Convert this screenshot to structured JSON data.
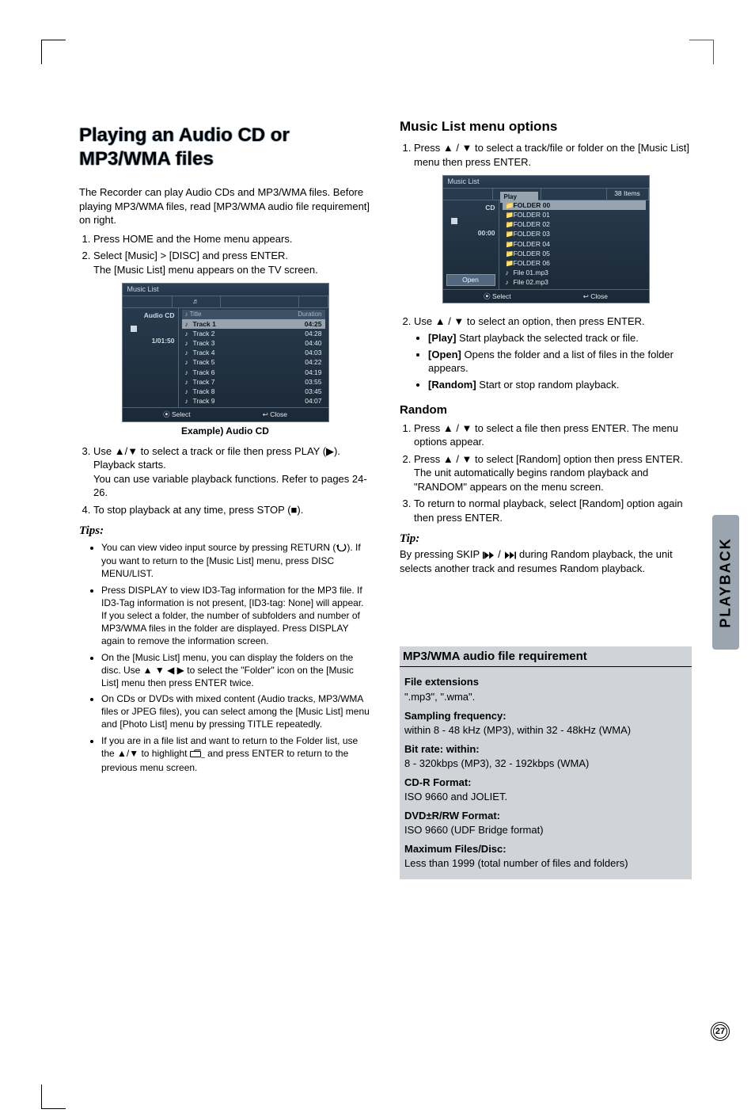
{
  "sideTab": "PLAYBACK",
  "pageNumber": "27",
  "left": {
    "title": "Playing an Audio CD or MP3/WMA files",
    "intro": "The Recorder can play Audio CDs and MP3/WMA files. Before playing MP3/WMA files, read [MP3/WMA audio file requirement] on right.",
    "step1": "Press HOME and the Home menu appears.",
    "step2a": "Select [Music] > [DISC] and press ENTER.",
    "step2b": "The [Music List] menu appears on the TV screen.",
    "exampleCaption": "Example) Audio CD",
    "step3a": "Use ▲/▼ to select a track or file then press PLAY (",
    "step3b": "). Playback starts.",
    "step3c": "You can use variable playback functions. Refer to pages 24-26.",
    "step4": "To stop playback at any time, press STOP (■).",
    "tipsLabel": "Tips:",
    "tip1a": "You can view video input source by pressing RETURN (",
    "tip1b": "). If you want to return to the [Music List] menu, press DISC MENU/LIST.",
    "tip2": "Press DISPLAY to view ID3-Tag information for the MP3 file. If ID3-Tag information is not present, [ID3-tag: None] will appear. If you select a folder, the number of subfolders and number of MP3/WMA files in the folder are displayed. Press DISPLAY again to remove the information screen.",
    "tip3": "On the [Music List] menu, you can display the folders on the disc. Use ▲ ▼ ◀ ▶ to select the \"Folder\" icon on the [Music List] menu then press ENTER twice.",
    "tip4": "On CDs or DVDs with mixed content (Audio tracks, MP3/WMA files or JPEG files), you can select among the [Music List] menu and [Photo List] menu by pressing TITLE repeatedly.",
    "tip5a": "If you are in a file list and want to return to the Folder list, use the ▲/▼ to highlight ",
    "tip5b": " and press ENTER to return to the previous menu screen.",
    "osd1": {
      "windowTitle": "Music List",
      "tabIcon": "♬",
      "side_label1": "Audio CD",
      "side_label2": "1/01:50",
      "head_title": "Title",
      "head_dur": "Duration",
      "tracks": [
        {
          "t": "Track 1",
          "d": "04:25"
        },
        {
          "t": "Track 2",
          "d": "04:28"
        },
        {
          "t": "Track 3",
          "d": "04:40"
        },
        {
          "t": "Track 4",
          "d": "04:03"
        },
        {
          "t": "Track 5",
          "d": "04:22"
        },
        {
          "t": "Track 6",
          "d": "04:19"
        },
        {
          "t": "Track 7",
          "d": "03:55"
        },
        {
          "t": "Track 8",
          "d": "03:45"
        },
        {
          "t": "Track 9",
          "d": "04:07"
        }
      ],
      "footer_select": "Select",
      "footer_close": "Close"
    }
  },
  "right": {
    "heading1": "Music List menu options",
    "r1": "Press ▲ / ▼ to select a track/file or folder on the [Music List] menu then press ENTER.",
    "osd2": {
      "windowTitle": "Music List",
      "tabIcon": "♬",
      "side_label1": "CD",
      "side_label2": "00:00",
      "btn_open": "Open",
      "hdr_items": "38 Items",
      "popup_play": "Play",
      "folders": [
        "FOLDER 00",
        "FOLDER 01",
        "FOLDER 02",
        "FOLDER 03",
        "FOLDER 04",
        "FOLDER 05",
        "FOLDER 06"
      ],
      "files": [
        "File 01.mp3",
        "File 02.mp3"
      ],
      "footer_select": "Select",
      "footer_close": "Close"
    },
    "r2": "Use ▲ / ▼ to select an option, then press ENTER.",
    "r2_play": "[Play] Start playback the selected track or file.",
    "r2_play_pre": "[Play]",
    "r2_play_post": " Start playback the selected track or file.",
    "r2_open_pre": "[Open]",
    "r2_open_post": " Opens the folder and a list of files in the folder appears.",
    "r2_random_pre": "[Random]",
    "r2_random_post": " Start or stop random playback.",
    "heading2": "Random",
    "rand1": "Press ▲ / ▼ to select a file then press ENTER. The menu options appear.",
    "rand2a": "Press ▲ / ▼ to select [Random] option then press ENTER.",
    "rand2b": "The unit automatically begins random playback and \"RANDOM\" appears on the menu screen.",
    "rand3": "To return to normal playback, select [Random] option again then press ENTER.",
    "tipLabel": "Tip:",
    "tipText_a": "By pressing SKIP ",
    "tipText_b": " during Random playback, the unit selects another track and resumes Random playback.",
    "reqTitle": "MP3/WMA audio file requirement",
    "req": {
      "fe_label": "File extensions",
      "fe_val": "\".mp3\", \".wma\".",
      "sf_label": "Sampling frequency:",
      "sf_val": "within 8 - 48 kHz (MP3), within 32 - 48kHz (WMA)",
      "br_label": "Bit rate: within:",
      "br_val": "8 - 320kbps (MP3), 32 - 192kbps (WMA)",
      "cdr_label": "CD-R Format:",
      "cdr_val": "ISO 9660 and JOLIET.",
      "dvd_label": "DVD±R/RW Format:",
      "dvd_val": "ISO 9660 (UDF Bridge format)",
      "max_label": "Maximum Files/Disc:",
      "max_val": "Less than 1999 (total number of files and folders)"
    }
  }
}
